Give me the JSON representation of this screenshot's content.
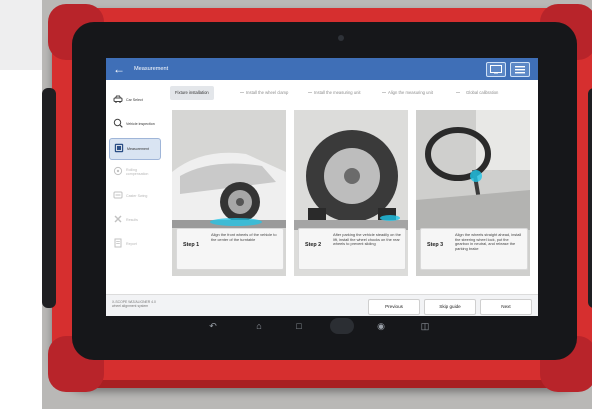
{
  "window": {
    "back_icon": "back-arrow-icon",
    "title": "Measurement",
    "buttons": [
      "display-icon",
      "menu-icon"
    ]
  },
  "sidebar": {
    "items": [
      {
        "label": "Car Select",
        "icon": "car-icon",
        "state": "normal"
      },
      {
        "label": "Vehicle inspection",
        "icon": "inspection-icon",
        "state": "normal"
      },
      {
        "label": "Measurement",
        "icon": "measurement-icon",
        "state": "active"
      },
      {
        "label": "Rolling compensation",
        "icon": "rolling-icon",
        "state": "disabled"
      },
      {
        "label": "Caster Swing",
        "icon": "caster-icon",
        "state": "disabled"
      },
      {
        "label": "Results",
        "icon": "results-icon",
        "state": "disabled"
      },
      {
        "label": "Report",
        "icon": "report-icon",
        "state": "disabled"
      }
    ]
  },
  "steps": [
    {
      "label": "Fixture installation",
      "active": true
    },
    {
      "label": "Install the wheel clamp",
      "active": false
    },
    {
      "label": "Install the measuring unit",
      "active": false
    },
    {
      "label": "Align the measuring unit",
      "active": false
    },
    {
      "label": "Global calibration",
      "active": false
    }
  ],
  "cards": [
    {
      "step": "Step 1",
      "text": "Align the front wheels of the vehicle to the center of the turntable"
    },
    {
      "step": "Step 2",
      "text": "After parking the vehicle steadily on the lift, install the wheel chocks on the rear wheels to prevent sliding"
    },
    {
      "step": "Step 3",
      "text": "Align the wheels straight ahead, install the steering wheel lock, put the gearbox in neutral, and release the parking brake"
    }
  ],
  "bottom": {
    "info_line1": "X-SCOPE WIZ/ALIGNER 4.0",
    "info_line2": "wheel alignment system",
    "previous": "Previous",
    "skip": "Skip guide",
    "next": "Next"
  },
  "navbar": {
    "icons": [
      "back-nav-icon",
      "home-icon",
      "recent-apps-icon",
      "gallery-icon",
      "vci-icon",
      "split-screen-icon"
    ]
  },
  "colors": {
    "accent": "#3f6fb7",
    "frame": "#d62f2f",
    "highlight": "#1fc6e8"
  }
}
